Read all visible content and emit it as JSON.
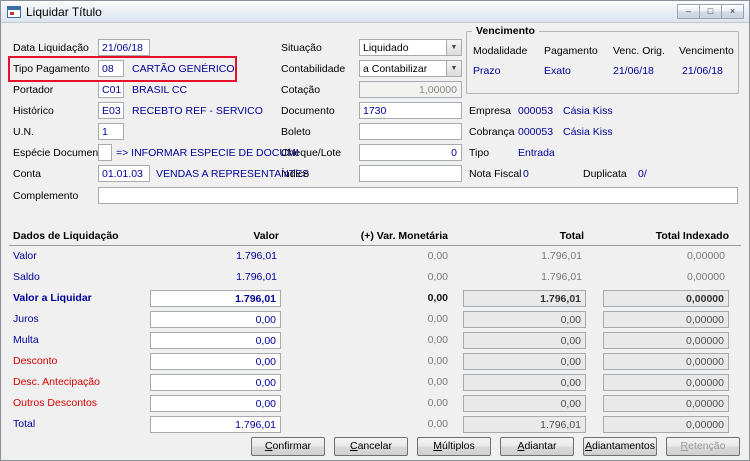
{
  "window": {
    "title": "Liquidar Título",
    "caption": {
      "minimize": "–",
      "maximize": "□",
      "close": "×"
    }
  },
  "fields": {
    "data_liquidacao": {
      "label": "Data Liquidação",
      "value": "21/06/18"
    },
    "tipo_pagamento": {
      "label": "Tipo Pagamento",
      "value": "08",
      "desc": "CARTÃO GENÉRICO"
    },
    "portador": {
      "label": "Portador",
      "value": "C01",
      "desc": "BRASIL CC"
    },
    "historico": {
      "label": "Histórico",
      "value": "E03",
      "desc": "RECEBTO REF - SERVICO"
    },
    "un": {
      "label": "U.N.",
      "value": "1"
    },
    "especie": {
      "label": "Espécie Documento",
      "value": "",
      "desc": "=> INFORMAR ESPECIE DE DOCUMI"
    },
    "conta": {
      "label": "Conta",
      "value": "01.01.03",
      "desc": "VENDAS A REPRESENTANTES"
    },
    "complemento": {
      "label": "Complemento",
      "value": ""
    },
    "situacao": {
      "label": "Situação",
      "value": "Liquidado"
    },
    "contabilidade": {
      "label": "Contabilidade",
      "value": "a Contabilizar"
    },
    "cotacao": {
      "label": "Cotação",
      "value": "1,00000"
    },
    "documento": {
      "label": "Documento",
      "value": "1730"
    },
    "boleto": {
      "label": "Boleto",
      "value": ""
    },
    "cheque_lote": {
      "label": "Cheque/Lote",
      "value": "0"
    },
    "indice": {
      "label": "Índice",
      "value": ""
    }
  },
  "vencimento": {
    "title": "Vencimento",
    "headers": [
      "Modalidade",
      "Pagamento",
      "Venc. Orig.",
      "Vencimento"
    ],
    "values": [
      "Prazo",
      "Exato",
      "21/06/18",
      "21/06/18"
    ]
  },
  "info": {
    "empresa": {
      "label": "Empresa",
      "code": "000053",
      "name": "Cásia Kiss"
    },
    "cobranca": {
      "label": "Cobrança",
      "code": "000053",
      "name": "Cásia Kiss"
    },
    "tipo": {
      "label": "Tipo",
      "value": "Entrada"
    },
    "nota_fiscal": {
      "label": "Nota Fiscal",
      "value": "0",
      "dup_label": "Duplicata",
      "dup_value": "0/"
    }
  },
  "grid": {
    "headers": [
      "Dados de Liquidação",
      "Valor",
      "(+) Var. Monetária",
      "Total",
      "Total Indexado"
    ],
    "rows": [
      {
        "label": "Valor",
        "valor": "1.796,01",
        "var": "0,00",
        "total": "1.796,01",
        "indexado": "0,00000"
      },
      {
        "label": "Saldo",
        "valor": "1.796,01",
        "var": "0,00",
        "total": "1.796,01",
        "indexado": "0,00000"
      },
      {
        "label": "Valor a Liquidar",
        "valor": "1.796,01",
        "var": "0,00",
        "total": "1.796,01",
        "indexado": "0,00000"
      },
      {
        "label": "Juros",
        "valor": "0,00",
        "var": "0,00",
        "total": "0,00",
        "indexado": "0,00000"
      },
      {
        "label": "Multa",
        "valor": "0,00",
        "var": "0,00",
        "total": "0,00",
        "indexado": "0,00000"
      },
      {
        "label": "Desconto",
        "valor": "0,00",
        "var": "0,00",
        "total": "0,00",
        "indexado": "0,00000"
      },
      {
        "label": "Desc. Antecipação",
        "valor": "0,00",
        "var": "0,00",
        "total": "0,00",
        "indexado": "0,00000"
      },
      {
        "label": "Outros Descontos",
        "valor": "0,00",
        "var": "0,00",
        "total": "0,00",
        "indexado": "0,00000"
      },
      {
        "label": "Total",
        "valor": "1.796,01",
        "var": "0,00",
        "total": "1.796,01",
        "indexado": "0,00000"
      }
    ]
  },
  "buttons": [
    {
      "u": "C",
      "rest": "onfirmar"
    },
    {
      "u": "C",
      "rest": "ancelar"
    },
    {
      "u": "M",
      "rest": "últiplos"
    },
    {
      "u": "A",
      "rest": "diantar"
    },
    {
      "u": "A",
      "rest": "diantamentos"
    },
    {
      "u": "R",
      "rest": "etenção"
    }
  ]
}
